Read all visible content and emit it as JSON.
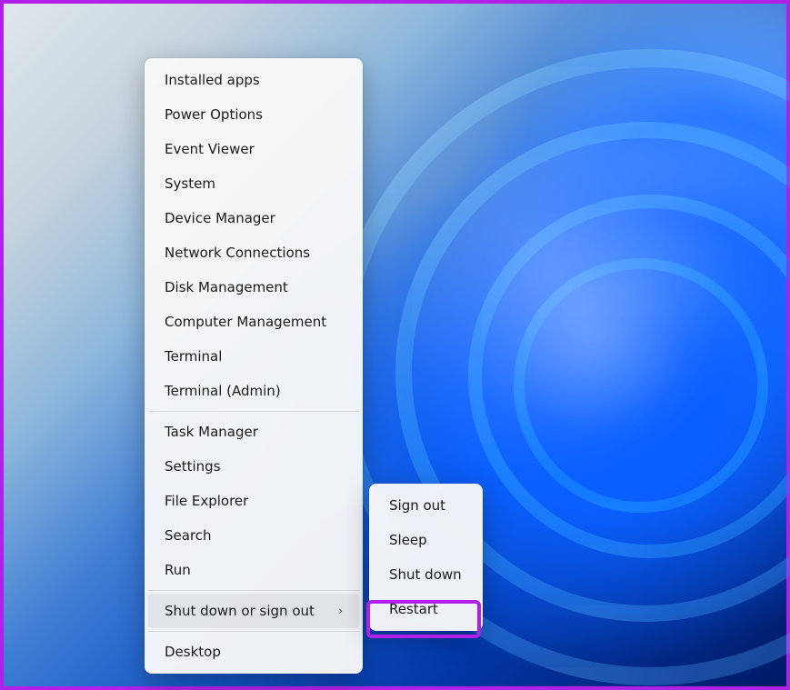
{
  "menu": {
    "groups": [
      [
        {
          "id": "installed-apps",
          "label": "Installed apps"
        },
        {
          "id": "power-options",
          "label": "Power Options"
        },
        {
          "id": "event-viewer",
          "label": "Event Viewer"
        },
        {
          "id": "system",
          "label": "System"
        },
        {
          "id": "device-manager",
          "label": "Device Manager"
        },
        {
          "id": "network-connections",
          "label": "Network Connections"
        },
        {
          "id": "disk-management",
          "label": "Disk Management"
        },
        {
          "id": "computer-management",
          "label": "Computer Management"
        },
        {
          "id": "terminal",
          "label": "Terminal"
        },
        {
          "id": "terminal-admin",
          "label": "Terminal (Admin)"
        }
      ],
      [
        {
          "id": "task-manager",
          "label": "Task Manager"
        },
        {
          "id": "settings",
          "label": "Settings"
        },
        {
          "id": "file-explorer",
          "label": "File Explorer"
        },
        {
          "id": "search",
          "label": "Search"
        },
        {
          "id": "run",
          "label": "Run"
        }
      ],
      [
        {
          "id": "shut-down-or-sign-out",
          "label": "Shut down or sign out",
          "submenu": true,
          "active": true
        }
      ],
      [
        {
          "id": "desktop",
          "label": "Desktop"
        }
      ]
    ]
  },
  "submenu": {
    "items": [
      {
        "id": "sign-out",
        "label": "Sign out"
      },
      {
        "id": "sleep",
        "label": "Sleep"
      },
      {
        "id": "shut-down",
        "label": "Shut down"
      },
      {
        "id": "restart",
        "label": "Restart",
        "highlighted": true
      }
    ]
  }
}
